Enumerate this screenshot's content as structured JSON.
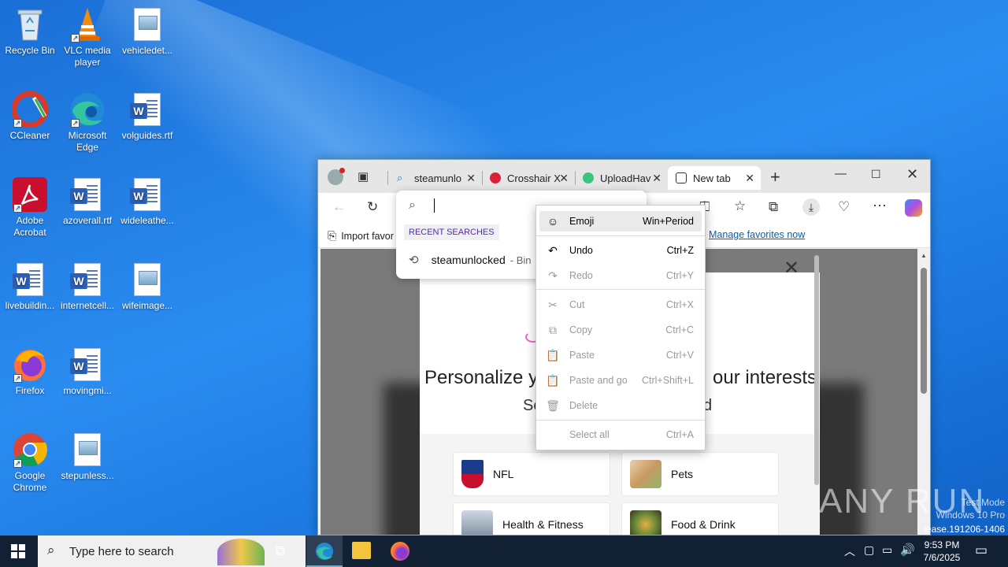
{
  "desktop": {
    "icons": [
      {
        "label": "Recycle Bin",
        "kind": "recycle-bin-icon"
      },
      {
        "label": "VLC media player",
        "kind": "vlc-icon"
      },
      {
        "label": "vehicledet...",
        "kind": "image-file-icon"
      },
      {
        "label": "CCleaner",
        "kind": "ccleaner-icon"
      },
      {
        "label": "Microsoft Edge",
        "kind": "edge-icon"
      },
      {
        "label": "volguides.rtf",
        "kind": "word-file-icon"
      },
      {
        "label": "Adobe Acrobat",
        "kind": "acrobat-icon"
      },
      {
        "label": "azoverall.rtf",
        "kind": "word-file-icon"
      },
      {
        "label": "wideleathe...",
        "kind": "word-file-icon"
      },
      {
        "label": "livebuildin...",
        "kind": "word-file-icon"
      },
      {
        "label": "internetcell...",
        "kind": "word-file-icon"
      },
      {
        "label": "wifeimage...",
        "kind": "image-file-icon"
      },
      {
        "label": "Firefox",
        "kind": "firefox-icon"
      },
      {
        "label": "movingmi...",
        "kind": "word-file-icon"
      },
      {
        "label": "Google Chrome",
        "kind": "chrome-icon"
      },
      {
        "label": "stepunless...",
        "kind": "image-file-icon"
      }
    ]
  },
  "browser": {
    "tabs": [
      {
        "title": "steamunlo",
        "favicon": "search-icon"
      },
      {
        "title": "Crosshair X",
        "favicon": "crosshair-icon"
      },
      {
        "title": "UploadHav",
        "favicon": "uploadhaven-icon"
      },
      {
        "title": "New tab",
        "favicon": "newtab-icon"
      }
    ],
    "favbar": {
      "import": "Import favor",
      "manage": "Manage favorites now"
    },
    "search_dropdown": {
      "header": "RECENT SEARCHES",
      "recent": "steamunlocked",
      "recent_source": "- Bin"
    },
    "modal": {
      "heading_left": "Personalize yo",
      "heading_right": "our interests",
      "sub_left": "Se",
      "sub_right": "d",
      "cards": [
        {
          "label": "NFL"
        },
        {
          "label": "Pets"
        },
        {
          "label": "Health & Fitness"
        },
        {
          "label": "Food & Drink"
        }
      ]
    }
  },
  "context_menu": {
    "items": [
      {
        "label": "Emoji",
        "shortcut": "Win+Period",
        "icon": "emoji-icon"
      },
      {
        "label": "Undo",
        "shortcut": "Ctrl+Z",
        "icon": "undo-icon"
      },
      {
        "label": "Redo",
        "shortcut": "Ctrl+Y",
        "icon": "redo-icon"
      },
      {
        "label": "Cut",
        "shortcut": "Ctrl+X",
        "icon": "cut-icon"
      },
      {
        "label": "Copy",
        "shortcut": "Ctrl+C",
        "icon": "copy-icon"
      },
      {
        "label": "Paste",
        "shortcut": "Ctrl+V",
        "icon": "paste-icon"
      },
      {
        "label": "Paste and go",
        "shortcut": "Ctrl+Shift+L",
        "icon": "paste-go-icon"
      },
      {
        "label": "Delete",
        "shortcut": "",
        "icon": "delete-icon"
      },
      {
        "label": "Select all",
        "shortcut": "Ctrl+A",
        "icon": ""
      }
    ]
  },
  "taskbar": {
    "search_placeholder": "Type here to search",
    "time": "9:53 PM",
    "date": "7/6/2025"
  },
  "watermark": {
    "brand": "ANY RUN",
    "line1": "Test Mode",
    "line2": "Windows 10 Pro",
    "line3": "lease.191206-1406"
  }
}
